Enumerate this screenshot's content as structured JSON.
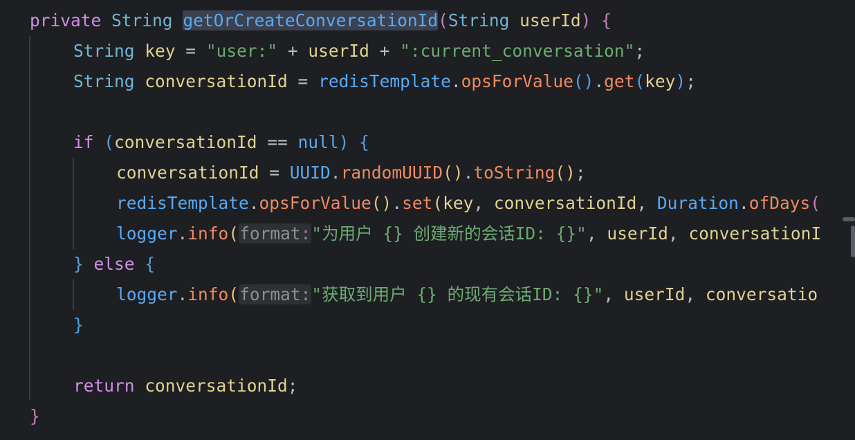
{
  "code": {
    "l1": {
      "private": "private",
      "string": "String",
      "name": "getOrCreateConversationId",
      "lparen": "(",
      "ptype": "String",
      "pname": "userId",
      "rparen": ")",
      "brace": "{"
    },
    "l2": {
      "type": "String",
      "var": "key",
      "eq": " = ",
      "s1": "\"user:\"",
      "plus1": " + ",
      "uid": "userId",
      "plus2": " + ",
      "s2": "\":current_conversation\"",
      "semi": ";"
    },
    "l3": {
      "type": "String",
      "var": "conversationId",
      "eq": " = ",
      "obj": "redisTemplate",
      "dot1": ".",
      "m1": "opsForValue",
      "p1": "()",
      "dot2": ".",
      "m2": "get",
      "lp": "(",
      "arg": "key",
      "rp": ")",
      "semi": ";"
    },
    "l5": {
      "if": "if",
      "lp": "(",
      "var": "conversationId",
      "eq": " == ",
      "nul": "null",
      "rp": ")",
      "brace": "{"
    },
    "l6": {
      "var": "conversationId",
      "eq": " = ",
      "cls": "UUID",
      "dot1": ".",
      "m1": "randomUUID",
      "p1": "()",
      "dot2": ".",
      "m2": "toString",
      "p2": "()",
      "semi": ";"
    },
    "l7": {
      "obj": "redisTemplate",
      "dot1": ".",
      "m1": "opsForValue",
      "p1": "()",
      "dot2": ".",
      "m2": "set",
      "lp": "(",
      "a1": "key",
      "c1": ", ",
      "a2": "conversationId",
      "c2": ", ",
      "cls": "Duration",
      "dot3": ".",
      "m3": "ofDays",
      "lp2": "("
    },
    "l8": {
      "obj": "logger",
      "dot": ".",
      "m": "info",
      "lp": "(",
      "hint": "format:",
      "str": "\"为用户 {} 创建新的会话ID: {}\"",
      "c1": ", ",
      "a1": "userId",
      "c2": ", ",
      "a2": "conversationI"
    },
    "l9": {
      "rb": "}",
      "else": "else",
      "lb": "{"
    },
    "l10": {
      "obj": "logger",
      "dot": ".",
      "m": "info",
      "lp": "(",
      "hint": "format:",
      "str": "\"获取到用户 {} 的现有会话ID: {}\"",
      "c1": ", ",
      "a1": "userId",
      "c2": ", ",
      "a2": "conversatio"
    },
    "l11": {
      "rb": "}"
    },
    "l13": {
      "ret": "return",
      "var": "conversationId",
      "semi": ";"
    },
    "l14": {
      "rb": "}"
    }
  },
  "colors": {
    "background": "#1e1f22",
    "keyword": "#cf8ee8",
    "type": "#6fb6d6",
    "method_declaration": "#57aaf7",
    "method_call": "#ef8a5f",
    "string": "#6aab73",
    "variable": "#e0d28f"
  }
}
